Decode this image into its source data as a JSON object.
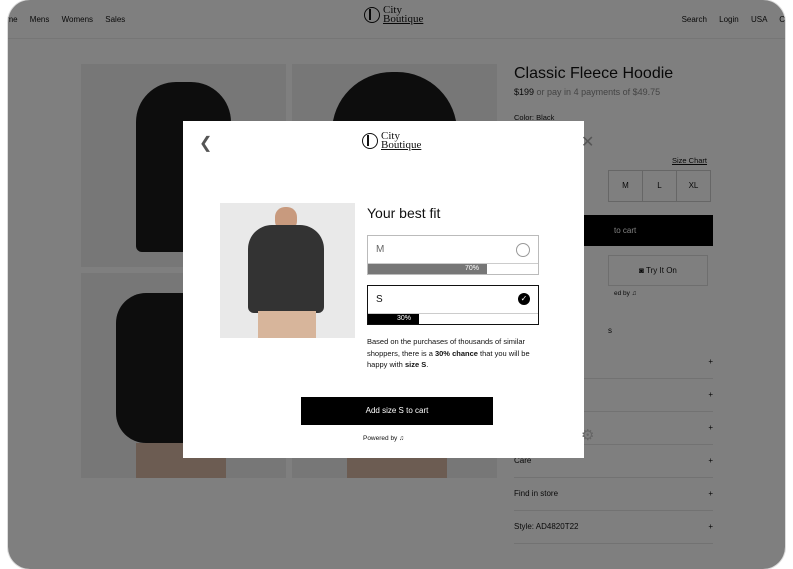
{
  "nav": {
    "left": [
      "ome",
      "Mens",
      "Womens",
      "Sales"
    ],
    "right": [
      "Search",
      "Login",
      "USA",
      "C"
    ]
  },
  "logo": {
    "line1": "City",
    "line2": "Boutique"
  },
  "product": {
    "title": "Classic Fleece Hoodie",
    "price": "$199",
    "installments": "or pay in 4 payments of $49.75",
    "color_label": "Color: Black",
    "size_chart": "Size Chart",
    "sizes": [
      "M",
      "L",
      "XL"
    ],
    "add_to_cart": "to cart",
    "try_it_on": "Try It On",
    "powered_partial": "ed by",
    "partial_s": "s",
    "accordion": [
      {
        "label": "",
        "icon": "+"
      },
      {
        "label": "",
        "icon": "+"
      },
      {
        "label": "",
        "icon": "+"
      },
      {
        "label": "Care",
        "icon": "+"
      },
      {
        "label": "Find in store",
        "icon": "+"
      },
      {
        "label": "Style: AD4820T22",
        "icon": "+"
      }
    ]
  },
  "modal": {
    "title": "Your best fit",
    "options": [
      {
        "size": "M",
        "percent": "70%",
        "pct_value": 70,
        "selected": false
      },
      {
        "size": "S",
        "percent": "30%",
        "pct_value": 30,
        "selected": true
      }
    ],
    "desc_1": "Based on the purchases of thousands of similar shoppers, there is a ",
    "desc_bold_1": "30% chance",
    "desc_2": " that you will be happy with ",
    "desc_bold_2": "size S",
    "desc_3": ".",
    "button": "Add size S to cart",
    "powered_by": "Powered by",
    "back_icon": "chevron-left-icon",
    "close_icon": "close-icon",
    "settings_icon": "gear-icon"
  }
}
